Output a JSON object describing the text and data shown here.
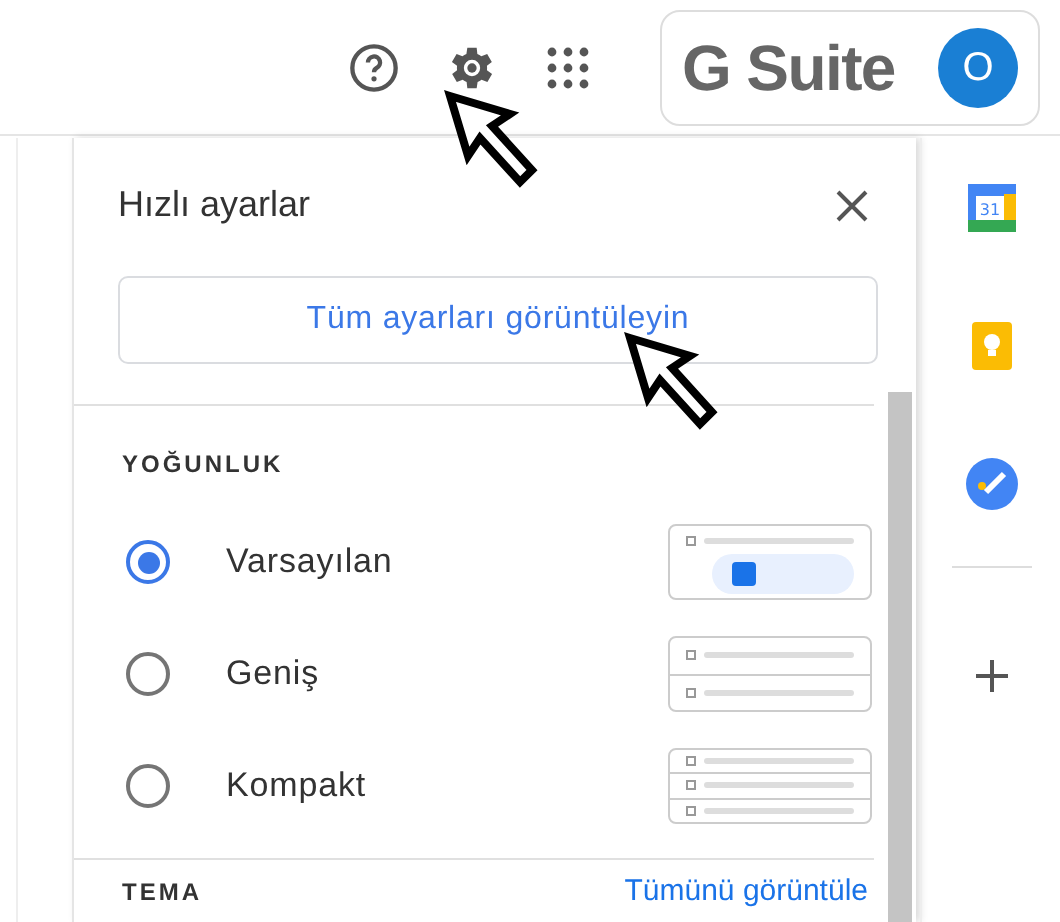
{
  "header": {
    "suite_label": "G Suite",
    "avatar_letter": "O"
  },
  "quick_settings": {
    "title": "Hızlı ayarlar",
    "all_settings_button": "Tüm ayarları görüntüleyin",
    "density": {
      "heading": "YOĞUNLUK",
      "options": [
        {
          "label": "Varsayılan",
          "kind": "default",
          "selected": true
        },
        {
          "label": "Geniş",
          "kind": "comfortable",
          "selected": false
        },
        {
          "label": "Kompakt",
          "kind": "compact",
          "selected": false
        }
      ]
    },
    "theme": {
      "heading": "TEMA",
      "link": "Tümünü görüntüle"
    }
  },
  "side_panel": {
    "calendar_day": "31"
  }
}
